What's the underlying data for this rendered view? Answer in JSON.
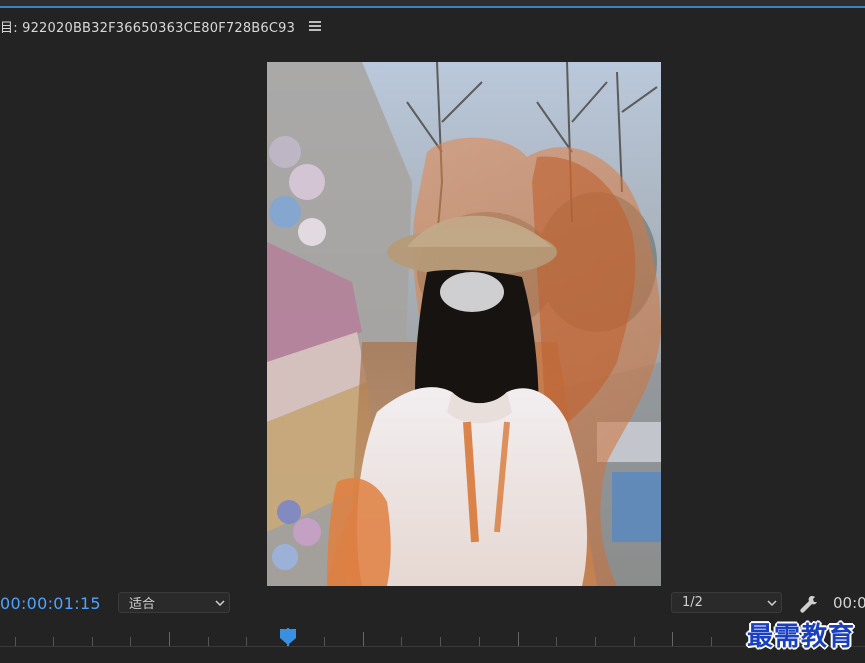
{
  "panel": {
    "title": "目: 922020BB32F36650363CE80F728B6C93"
  },
  "footer": {
    "timecode": "00:00:01:15",
    "zoom_value": "适合",
    "resolution_value": "1/2",
    "timecode_right": "00:0"
  },
  "watermark": {
    "text": "最需教育"
  },
  "colors": {
    "accent_blue": "#4fa3ff",
    "panel_bg": "#232323",
    "watermark_blue": "#1a3fbf"
  },
  "icons": {
    "menu": "hamburger-menu-icon",
    "chevron": "chevron-down-icon",
    "settings": "wrench-icon",
    "playhead": "playhead-marker-icon"
  }
}
